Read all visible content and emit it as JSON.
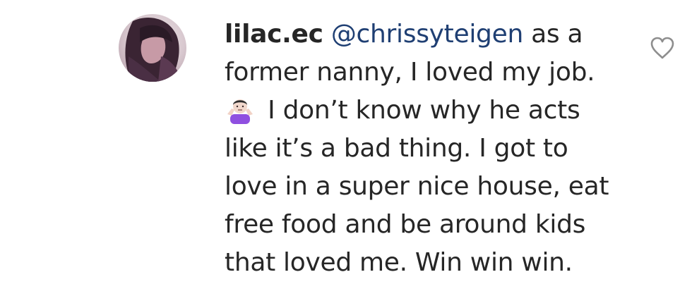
{
  "comment": {
    "username": "lilac.ec",
    "mention": "@chrissyteigen",
    "line1_after_mention": " as a",
    "lines": [
      "former nanny, I loved my job.",
      " I don’t know why he acts",
      "like it’s a bad thing. I got to",
      "love in a super nice house, eat",
      "free food and be around kids",
      "that loved me. Win win win."
    ],
    "emoji": "person-shrugging-emoji",
    "like_icon": "heart-outline-icon"
  },
  "colors": {
    "text": "#262626",
    "mention": "#1f3f73",
    "icon": "#8e8e8e"
  }
}
